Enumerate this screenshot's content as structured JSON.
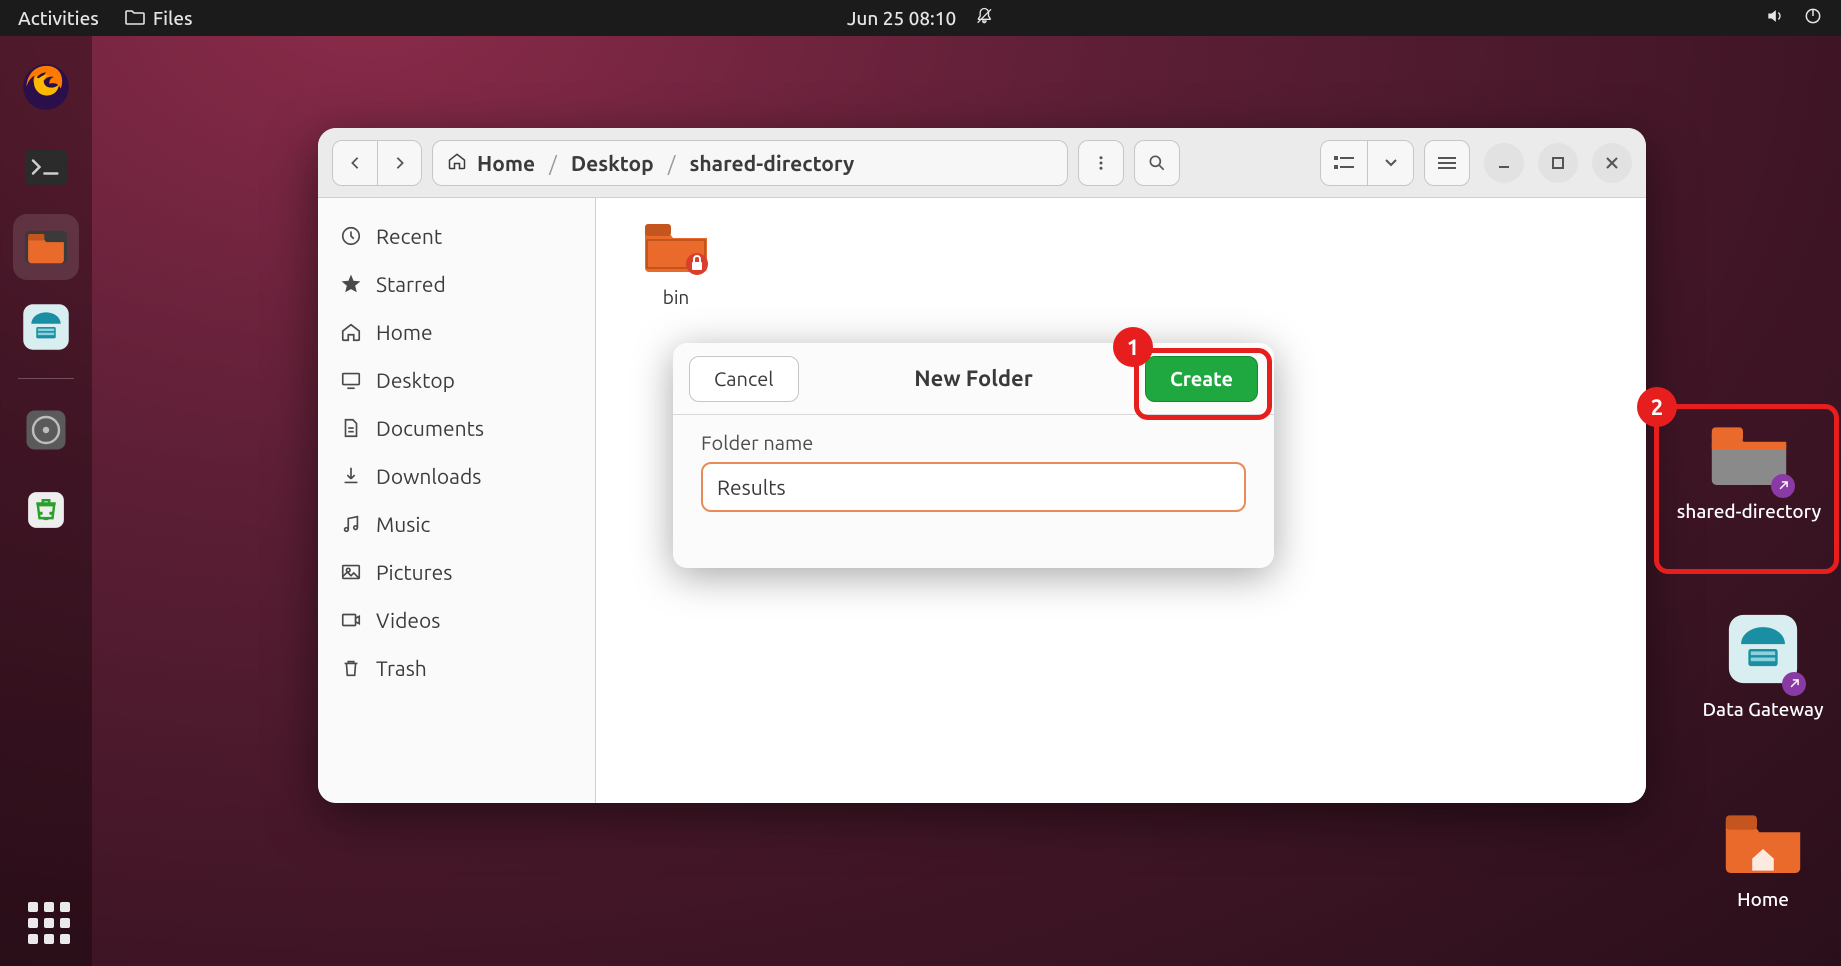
{
  "topbar": {
    "activities": "Activities",
    "app_indicator": "Files",
    "clock": "Jun 25  08:10"
  },
  "dock": {
    "items": [
      "firefox",
      "terminal",
      "files",
      "data-gateway",
      "disk",
      "trash"
    ]
  },
  "files_window": {
    "breadcrumb": {
      "home": "Home",
      "desktop": "Desktop",
      "current": "shared-directory"
    },
    "sidebar": [
      {
        "id": "recent",
        "label": "Recent"
      },
      {
        "id": "starred",
        "label": "Starred"
      },
      {
        "id": "home",
        "label": "Home"
      },
      {
        "id": "desktop",
        "label": "Desktop"
      },
      {
        "id": "documents",
        "label": "Documents"
      },
      {
        "id": "downloads",
        "label": "Downloads"
      },
      {
        "id": "music",
        "label": "Music"
      },
      {
        "id": "pictures",
        "label": "Pictures"
      },
      {
        "id": "videos",
        "label": "Videos"
      },
      {
        "id": "trash",
        "label": "Trash"
      }
    ],
    "content": {
      "folder1_name": "bin"
    }
  },
  "dialog": {
    "title": "New Folder",
    "cancel": "Cancel",
    "create": "Create",
    "field_label": "Folder name",
    "field_value": "Results"
  },
  "annotations": {
    "badge1": "1",
    "badge2": "2"
  },
  "desktop": {
    "shared_dir": "shared-directory",
    "data_gateway": "Data Gateway",
    "home": "Home"
  }
}
